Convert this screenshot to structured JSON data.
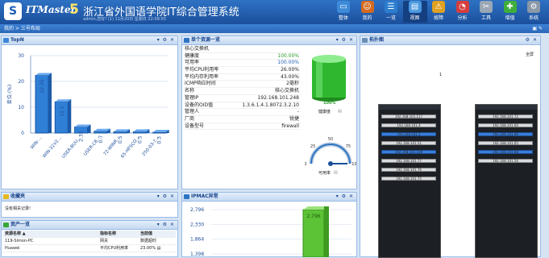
{
  "header": {
    "logo_glyph": "S",
    "brand": "ITMaster",
    "brand_version": "5",
    "system_name": "浙江省外国语学院IT综合管理系统",
    "user_line": "admin,您好! (1) 11月20日 星期日 22:09:55"
  },
  "nav": [
    {
      "label": "整体",
      "icon": "monitor-icon",
      "color": "#3d8ad8",
      "glyph": "▭"
    },
    {
      "label": "我的",
      "icon": "user-icon",
      "color": "#d46a1f",
      "glyph": "☺"
    },
    {
      "label": "一览",
      "icon": "list-icon",
      "color": "#2d7ecf",
      "glyph": "☰"
    },
    {
      "label": "视图",
      "icon": "chart-view-icon",
      "color": "#4a98e0",
      "glyph": "▤"
    },
    {
      "label": "故障",
      "icon": "warning-icon",
      "color": "#e0a020",
      "glyph": "⚠"
    },
    {
      "label": "分析",
      "icon": "pie-icon",
      "color": "#d63d3d",
      "glyph": "◔"
    },
    {
      "label": "工具",
      "icon": "tools-icon",
      "color": "#9aa7b5",
      "glyph": "✂"
    },
    {
      "label": "增值",
      "icon": "plus-icon",
      "color": "#3fae3a",
      "glyph": "✚"
    },
    {
      "label": "系统",
      "icon": "gear-icon",
      "color": "#8b98a8",
      "glyph": "⚙"
    }
  ],
  "breadcrumb": {
    "text": "我的 > 三号布局",
    "right": "▣ ✎"
  },
  "topn": {
    "title": "TopN",
    "tools": "▾ ⚙ ✕",
    "chart_data": {
      "type": "bar",
      "categories": [
        "WIN-...",
        "WIN-31V2...",
        "USER-BUU...",
        "USER-C8...",
        "72-WINR...",
        "65-HFSCO...",
        "250-03-?..."
      ],
      "values": [
        22.35,
        12.1,
        2.35,
        0.7,
        0.5,
        0.5,
        0.3
      ],
      "value_labels": [
        "22.35",
        "12.1",
        "2.35",
        "0.7",
        "0.5",
        "0.5",
        "0.3"
      ],
      "ylabel": "单位:(%)",
      "ylim": [
        0,
        30
      ],
      "yticks": [
        "0",
        "10",
        "20",
        "30"
      ],
      "grid": true
    }
  },
  "single": {
    "title": "单个资源一览",
    "tools": "▾ ⚙ ✕",
    "rows": [
      {
        "k": "核心交换机",
        "v": "",
        "cls": ""
      },
      {
        "k": "健康度",
        "v": "100.00%",
        "cls": "g"
      },
      {
        "k": "可用率",
        "v": "100.00%",
        "cls": "b"
      },
      {
        "k": "平均CPU利用率",
        "v": "26.00%",
        "cls": ""
      },
      {
        "k": "平均内存利用率",
        "v": "43.00%",
        "cls": ""
      },
      {
        "k": "ICMP响应时间",
        "v": "2毫秒",
        "cls": ""
      },
      {
        "k": "名称",
        "v": "核心交换机",
        "cls": ""
      },
      {
        "k": "管理IP",
        "v": "192.168.101.248",
        "cls": ""
      },
      {
        "k": "设备的OID值",
        "v": "1.3.6.1.4.1.8072.3.2.10",
        "cls": ""
      },
      {
        "k": "管理人",
        "v": "-",
        "cls": ""
      },
      {
        "k": "厂商",
        "v": "锐捷",
        "cls": ""
      },
      {
        "k": "设备型号",
        "v": "firewall",
        "cls": ""
      }
    ],
    "health_pct": "100%",
    "health_label": "健康度",
    "health_value": 1.0,
    "avail_label": "可用率",
    "gauge_ticks": [
      "0",
      "25",
      "50",
      "75",
      "100"
    ],
    "gauge_value": 100
  },
  "topo": {
    "title": "拓扑图",
    "fullscreen": "全屏",
    "num": "1",
    "tools": "⚙ ✕"
  },
  "racks": {
    "left": [
      "192.168.101.117",
      "192.168.101.4",
      "192.168.101.1",
      "192.168.101.51",
      "192.168.101.100",
      "192.168.101.77",
      "192.168.101.76",
      "192.168.101.75"
    ],
    "right": [
      "192.168.101.72",
      "192.168.101.60",
      "192.168.101.66",
      "192.168.101.65",
      "192.168.101.68",
      "192.168.101.54"
    ]
  },
  "fav": {
    "title": "收藏夹",
    "tools": "▾ ⚙ ✕",
    "empty": "没有相关记录!"
  },
  "ipmac": {
    "title": "IPMAC异常",
    "tools": "▾ ⚙ ✕",
    "chart_data": {
      "type": "bar",
      "yticks": [
        "2,796",
        "2,330",
        "1,864",
        "1,398"
      ],
      "values": [
        2796
      ],
      "value_labels": [
        "2,796"
      ]
    }
  },
  "list": {
    "title": "资产一览",
    "tools": "▾ ⚙ ✕",
    "headers": [
      "资源名称 ▲",
      "指标名称",
      "当前值"
    ],
    "rows": [
      [
        "119-Simon-PC",
        "网关",
        "数据超时"
      ],
      [
        "Huawei",
        "平均CPU利用率",
        "23.00% ▤"
      ]
    ]
  }
}
